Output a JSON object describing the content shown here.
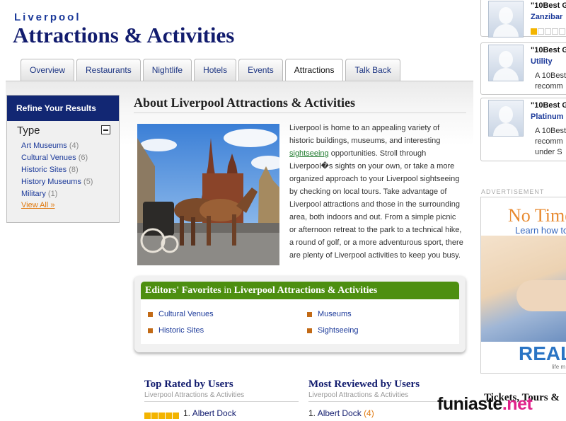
{
  "header": {
    "city": "Liverpool",
    "title": "Attractions & Activities"
  },
  "tabs": [
    {
      "label": "Overview"
    },
    {
      "label": "Restaurants"
    },
    {
      "label": "Nightlife"
    },
    {
      "label": "Hotels"
    },
    {
      "label": "Events"
    },
    {
      "label": "Attractions",
      "active": true
    },
    {
      "label": "Talk Back"
    }
  ],
  "sidebar": {
    "heading": "Refine Your Results",
    "type_label": "Type",
    "filters": [
      {
        "label": "Art Museums",
        "count": "(4)"
      },
      {
        "label": "Cultural Venues",
        "count": "(6)"
      },
      {
        "label": "Historic Sites",
        "count": "(8)"
      },
      {
        "label": "History Museums",
        "count": "(5)"
      },
      {
        "label": "Military",
        "count": "(1)"
      }
    ],
    "view_all": "View All »"
  },
  "about": {
    "title": "About Liverpool Attractions & Activities",
    "text_before": "Liverpool is home to an appealing variety of historic buildings, museums, and interesting ",
    "link": "sightseeing",
    "text_after": " opportunities. Stroll through Liverpool�s sights on your own, or take a more organized approach to your Liverpool sightseeing by checking on local tours. Take advantage of Liverpool attractions and those in the surrounding area, both indoors and out. From a simple picnic or afternoon retreat to the park to a technical hike, a round of golf, or a more adventurous sport, there are plenty of Liverpool activities to keep you busy."
  },
  "editors": {
    "title_a": "Editors' Favorites",
    "title_in": " in ",
    "title_b": "Liverpool Attractions & Activities",
    "items": [
      "Cultural Venues",
      "Museums",
      "Historic Sites",
      "Sightseeing"
    ]
  },
  "top_rated": {
    "title": "Top Rated by Users",
    "subtitle": "Liverpool Attractions & Activities",
    "first_num": "1.",
    "first_item": "Albert Dock"
  },
  "most_reviewed": {
    "title": "Most Reviewed by Users",
    "subtitle": "Liverpool Attractions & Activities",
    "first_num": "1.",
    "first_item": "Albert Dock",
    "first_count": "(4)"
  },
  "right": {
    "cards": [
      {
        "title": "\"10Best G",
        "name": "Zanzibar"
      },
      {
        "title": "\"10Best G",
        "name": "Utility",
        "line1": "A 10Best",
        "line2": "recomm"
      },
      {
        "title": "\"10Best G",
        "name": "Platinum",
        "line1": "A 10Best",
        "line2": "recomm",
        "line3": "under S"
      }
    ],
    "ad_label": "ADVERTISEMENT",
    "ad_headline": "No Time",
    "ad_sub": "Learn how to",
    "ad_brand": "REAL",
    "ad_small": "life m",
    "bottom_title": "Tickets, Tours & "
  },
  "watermark": {
    "a": "funiaste",
    "b": ".net"
  }
}
